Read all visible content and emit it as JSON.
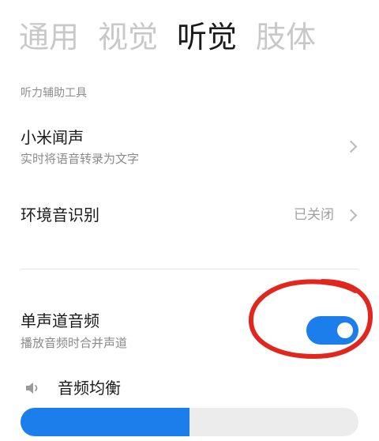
{
  "tabs": [
    {
      "label": "通用",
      "active": false
    },
    {
      "label": "视觉",
      "active": false
    },
    {
      "label": "听觉",
      "active": true
    },
    {
      "label": "肢体",
      "active": false
    }
  ],
  "section_header": "听力辅助工具",
  "rows": {
    "xiaomi_wensheng": {
      "title": "小米闻声",
      "subtitle": "实时将语音转录为文字"
    },
    "ambient_sound": {
      "title": "环境音识别",
      "value": "已关闭"
    },
    "mono_audio": {
      "title": "单声道音频",
      "subtitle": "播放音频时合并声道",
      "enabled": true
    }
  },
  "audio_balance": {
    "label": "音频均衡",
    "value_fraction": 0.5
  },
  "colors": {
    "accent": "#1c7eea",
    "highlight_circle": "#e0261d",
    "track": "#ececec",
    "inactive_tab": "#c8c8c8"
  },
  "icons": {
    "row_chevron": "chevron-right-icon",
    "balance": "speaker-icon"
  }
}
